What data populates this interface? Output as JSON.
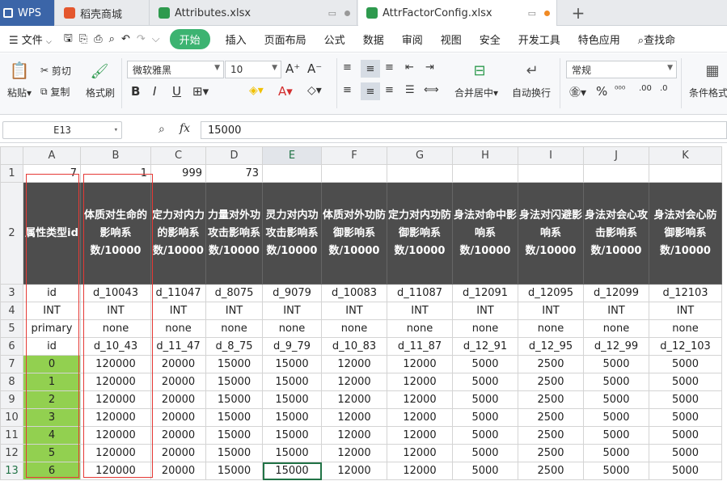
{
  "tabs": [
    {
      "label": "WPS",
      "color": "#3b65a8"
    },
    {
      "label": "稻壳商城",
      "color": "#e4572e"
    },
    {
      "label": "Attributes.xlsx",
      "color": "#2e9a4e"
    },
    {
      "label": "AttrFactorConfig.xlsx",
      "color": "#2e9a4e"
    }
  ],
  "menu": [
    "文件",
    "开始",
    "插入",
    "页面布局",
    "公式",
    "数据",
    "审阅",
    "视图",
    "安全",
    "开发工具",
    "特色应用",
    "查找命"
  ],
  "ribbon": {
    "paste": "粘贴",
    "cut": "剪切",
    "copy": "复制",
    "format_painter": "格式刷",
    "font_name": "微软雅黑",
    "font_size": "10",
    "merge": "合并居中",
    "wrap": "自动换行",
    "number_format": "常规",
    "cond_format": "条件格式"
  },
  "formula_bar": {
    "cell_ref": "E13",
    "fx": "fx",
    "value": "15000"
  },
  "columns": [
    "A",
    "B",
    "C",
    "D",
    "E",
    "F",
    "G",
    "H",
    "I",
    "J",
    "K"
  ],
  "rows": [
    {
      "n": "1",
      "cells": [
        "7",
        "1",
        "999",
        "73",
        "",
        "",
        "",
        "",
        "",
        "",
        ""
      ]
    },
    {
      "n": "2",
      "cells": [
        "属性类型id",
        "体质对生命的影响系数/10000",
        "定力对内力的影响系数/10000",
        "力量对外功攻击影响系数/10000",
        "灵力对内功攻击影响系数/10000",
        "体质对外功防御影响系数/10000",
        "定力对内功防御影响系数/10000",
        "身法对命中影响系数/10000",
        "身法对闪避影响系数/10000",
        "身法对会心攻击影响系数/10000",
        "身法对会心防御影响系数/10000"
      ]
    },
    {
      "n": "3",
      "cells": [
        "id",
        "d_10043",
        "d_11047",
        "d_8075",
        "d_9079",
        "d_10083",
        "d_11087",
        "d_12091",
        "d_12095",
        "d_12099",
        "d_12103"
      ]
    },
    {
      "n": "4",
      "cells": [
        "INT",
        "INT",
        "INT",
        "INT",
        "INT",
        "INT",
        "INT",
        "INT",
        "INT",
        "INT",
        "INT"
      ]
    },
    {
      "n": "5",
      "cells": [
        "primary",
        "none",
        "none",
        "none",
        "none",
        "none",
        "none",
        "none",
        "none",
        "none",
        "none"
      ]
    },
    {
      "n": "6",
      "cells": [
        "id",
        "d_10_43",
        "d_11_47",
        "d_8_75",
        "d_9_79",
        "d_10_83",
        "d_11_87",
        "d_12_91",
        "d_12_95",
        "d_12_99",
        "d_12_103"
      ]
    },
    {
      "n": "7",
      "cells": [
        "0",
        "120000",
        "20000",
        "15000",
        "15000",
        "12000",
        "12000",
        "5000",
        "2500",
        "5000",
        "5000"
      ]
    },
    {
      "n": "8",
      "cells": [
        "1",
        "120000",
        "20000",
        "15000",
        "15000",
        "12000",
        "12000",
        "5000",
        "2500",
        "5000",
        "5000"
      ]
    },
    {
      "n": "9",
      "cells": [
        "2",
        "120000",
        "20000",
        "15000",
        "15000",
        "12000",
        "12000",
        "5000",
        "2500",
        "5000",
        "5000"
      ]
    },
    {
      "n": "10",
      "cells": [
        "3",
        "120000",
        "20000",
        "15000",
        "15000",
        "12000",
        "12000",
        "5000",
        "2500",
        "5000",
        "5000"
      ]
    },
    {
      "n": "11",
      "cells": [
        "4",
        "120000",
        "20000",
        "15000",
        "15000",
        "12000",
        "12000",
        "5000",
        "2500",
        "5000",
        "5000"
      ]
    },
    {
      "n": "12",
      "cells": [
        "5",
        "120000",
        "20000",
        "15000",
        "15000",
        "12000",
        "12000",
        "5000",
        "2500",
        "5000",
        "5000"
      ]
    },
    {
      "n": "13",
      "cells": [
        "6",
        "120000",
        "20000",
        "15000",
        "15000",
        "12000",
        "12000",
        "5000",
        "2500",
        "5000",
        "5000"
      ]
    }
  ],
  "colors": {
    "header_fill": "#4d4d4d",
    "id_fill": "#92d050",
    "accent": "#217346",
    "start_button": "#3cb371"
  }
}
